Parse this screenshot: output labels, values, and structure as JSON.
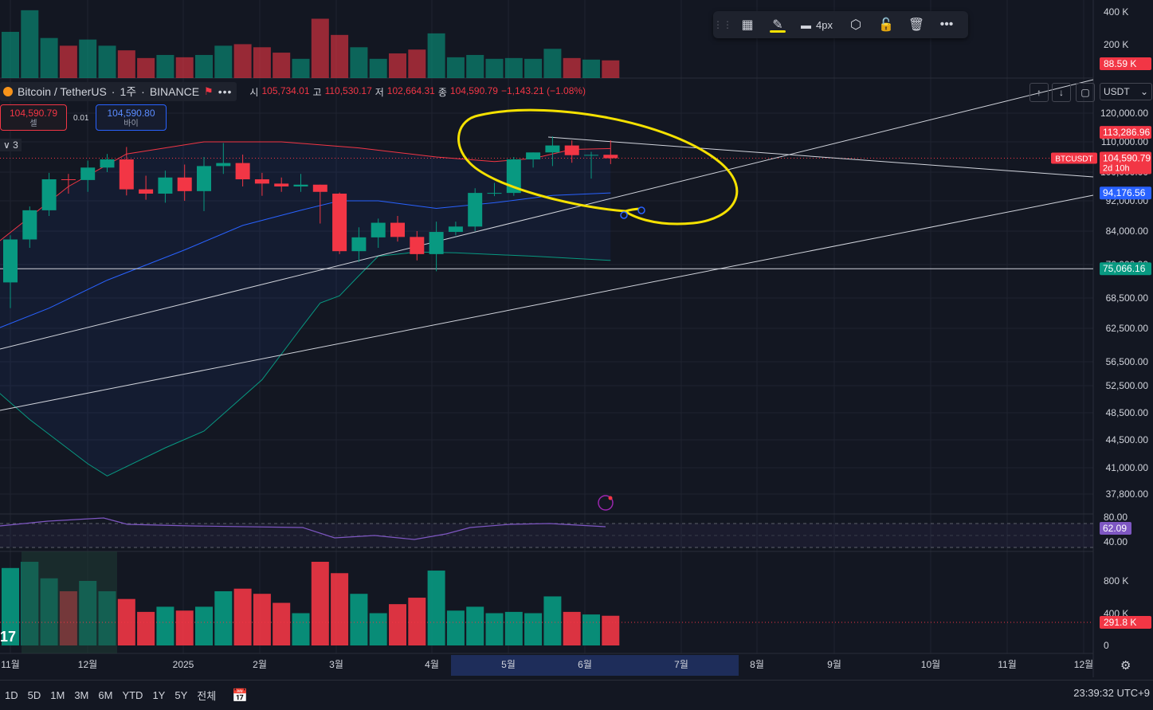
{
  "legend": {
    "symbol": "Bitcoin / TetherUS",
    "interval": "1주",
    "exchange": "BINANCE",
    "open_label": "시",
    "open": "105,734.01",
    "high_label": "고",
    "high": "110,530.17",
    "low_label": "저",
    "low": "102,664.31",
    "close_label": "종",
    "close": "104,590.79",
    "change": "−1,143.21 (−1.08%)"
  },
  "trade": {
    "sell_price": "104,590.79",
    "sell_label": "셀",
    "buy_price": "104,590.80",
    "buy_label": "바이",
    "spread": "0.01"
  },
  "indicator_count": "3",
  "drawing_toolbar": {
    "width_label": "4px"
  },
  "currency": "USDT",
  "colors": {
    "up": "#089981",
    "down": "#f23645",
    "highlight": "#f5e100",
    "ma": "#2962ff",
    "rsi": "#7e57c2"
  },
  "chart_data": {
    "type": "candlestick",
    "symbol": "BTCUSDT",
    "ylim": [
      37000,
      121000
    ],
    "price_ticks": [
      120000,
      110000,
      100000,
      92000,
      84000,
      76000,
      68500,
      62500,
      56500,
      52500,
      48500,
      44500,
      41000,
      37800
    ],
    "price_tick_labels": [
      "120,000.00",
      "110,000.00",
      "100,000.00",
      "92,000.00",
      "84,000.00",
      "76,000.00",
      "68,500.00",
      "62,500.00",
      "56,500.00",
      "52,500.00",
      "48,500.00",
      "44,500.00",
      "41,000.00",
      "37,800.00"
    ],
    "month_labels": [
      "11월",
      "12월",
      "2025",
      "2월",
      "3월",
      "4월",
      "5월",
      "6월",
      "7월",
      "8월",
      "9월",
      "10월",
      "11월",
      "12월"
    ],
    "candles": [
      {
        "o": 72000,
        "h": 83000,
        "l": 66500,
        "c": 82000
      },
      {
        "o": 82000,
        "h": 90500,
        "l": 80000,
        "c": 89500
      },
      {
        "o": 89500,
        "h": 99800,
        "l": 88000,
        "c": 98000
      },
      {
        "o": 98000,
        "h": 99500,
        "l": 94000,
        "c": 97800
      },
      {
        "o": 97800,
        "h": 103800,
        "l": 94500,
        "c": 101500
      },
      {
        "o": 101500,
        "h": 106000,
        "l": 100000,
        "c": 104200
      },
      {
        "o": 104200,
        "h": 108300,
        "l": 93500,
        "c": 95200
      },
      {
        "o": 95200,
        "h": 99000,
        "l": 92300,
        "c": 94000
      },
      {
        "o": 94000,
        "h": 100500,
        "l": 91500,
        "c": 98500
      },
      {
        "o": 98500,
        "h": 102500,
        "l": 92000,
        "c": 94700
      },
      {
        "o": 94700,
        "h": 105000,
        "l": 89300,
        "c": 102000
      },
      {
        "o": 102000,
        "h": 109600,
        "l": 99500,
        "c": 103000
      },
      {
        "o": 103000,
        "h": 105800,
        "l": 96000,
        "c": 98000
      },
      {
        "o": 98000,
        "h": 99800,
        "l": 93400,
        "c": 96800
      },
      {
        "o": 96800,
        "h": 98500,
        "l": 94500,
        "c": 96000
      },
      {
        "o": 96000,
        "h": 99500,
        "l": 94500,
        "c": 96500
      },
      {
        "o": 96500,
        "h": 96500,
        "l": 86000,
        "c": 94500
      },
      {
        "o": 94000,
        "h": 94300,
        "l": 78500,
        "c": 79200
      },
      {
        "o": 79200,
        "h": 85000,
        "l": 76600,
        "c": 82500
      },
      {
        "o": 82500,
        "h": 87300,
        "l": 80000,
        "c": 86200
      },
      {
        "o": 86200,
        "h": 88000,
        "l": 81500,
        "c": 82600
      },
      {
        "o": 82600,
        "h": 84000,
        "l": 77000,
        "c": 78500
      },
      {
        "o": 78500,
        "h": 86500,
        "l": 74500,
        "c": 83800
      },
      {
        "o": 83800,
        "h": 86500,
        "l": 83000,
        "c": 85200
      },
      {
        "o": 85200,
        "h": 95500,
        "l": 84000,
        "c": 94200
      },
      {
        "o": 94200,
        "h": 97000,
        "l": 93300,
        "c": 94200
      },
      {
        "o": 94200,
        "h": 105000,
        "l": 93400,
        "c": 104200
      },
      {
        "o": 104200,
        "h": 106500,
        "l": 101500,
        "c": 106500
      },
      {
        "o": 106500,
        "h": 111900,
        "l": 102000,
        "c": 108800
      },
      {
        "o": 108800,
        "h": 110500,
        "l": 103100,
        "c": 105600
      },
      {
        "o": 105600,
        "h": 106700,
        "l": 98200,
        "c": 105700
      },
      {
        "o": 105734,
        "h": 110530,
        "l": 102664,
        "c": 104591
      }
    ],
    "price_labels": [
      {
        "text": "113,286.96",
        "value": 113287,
        "color": "#f23645"
      },
      {
        "text": "104,590.79",
        "sub": "2d 10h",
        "value": 104591,
        "color": "#f23645",
        "tag": "BTCUSDT"
      },
      {
        "text": "94,176.56",
        "value": 94177,
        "color": "#2962ff"
      },
      {
        "text": "75,066.16",
        "value": 75066,
        "color": "#089981"
      }
    ],
    "rsi": {
      "value_label": "62.09",
      "ticks": [
        "80.00",
        "40.00"
      ]
    },
    "volume": {
      "top_ticks": [
        "400 K",
        "200 K"
      ],
      "top_label": "88.59 K",
      "bottom_ticks": [
        "800 K",
        "400 K",
        "0"
      ],
      "last_label": "291.8 K"
    }
  },
  "bottom": {
    "ranges": [
      "1D",
      "5D",
      "1M",
      "3M",
      "6M",
      "YTD",
      "1Y",
      "5Y",
      "전체"
    ],
    "clock": "23:39:32 UTC+9"
  }
}
